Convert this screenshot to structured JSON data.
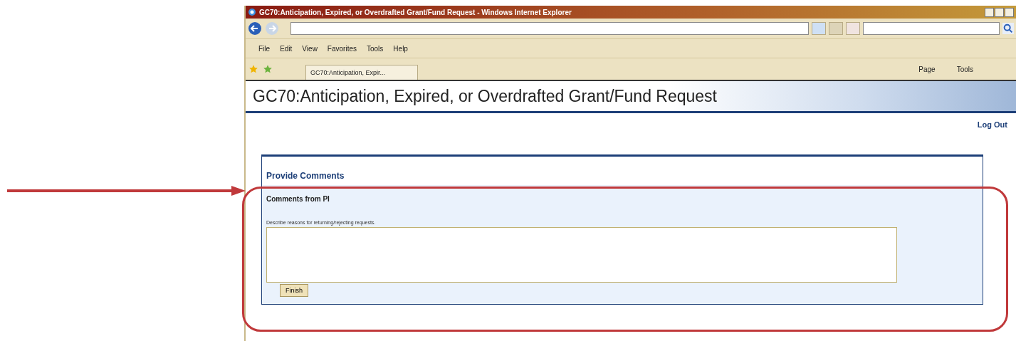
{
  "window": {
    "title": "GC70:Anticipation, Expired, or Overdrafted Grant/Fund Request - Windows Internet Explorer"
  },
  "menu": [
    "File",
    "Edit",
    "View",
    "Favorites",
    "Tools",
    "Help"
  ],
  "tabs": [
    {
      "label": "GC70:Anticipation, Expir...",
      "selected": true
    }
  ],
  "command_bar": [
    "Page",
    "Tools"
  ],
  "page": {
    "title": "GC70:Anticipation, Expired, or Overdrafted Grant/Fund Request",
    "logout": "Log Out"
  },
  "form": {
    "heading": "Provide Comments",
    "subheading": "Comments from PI",
    "instruction": "Describe reasons for returning/rejecting requests.",
    "button": "Finish"
  }
}
